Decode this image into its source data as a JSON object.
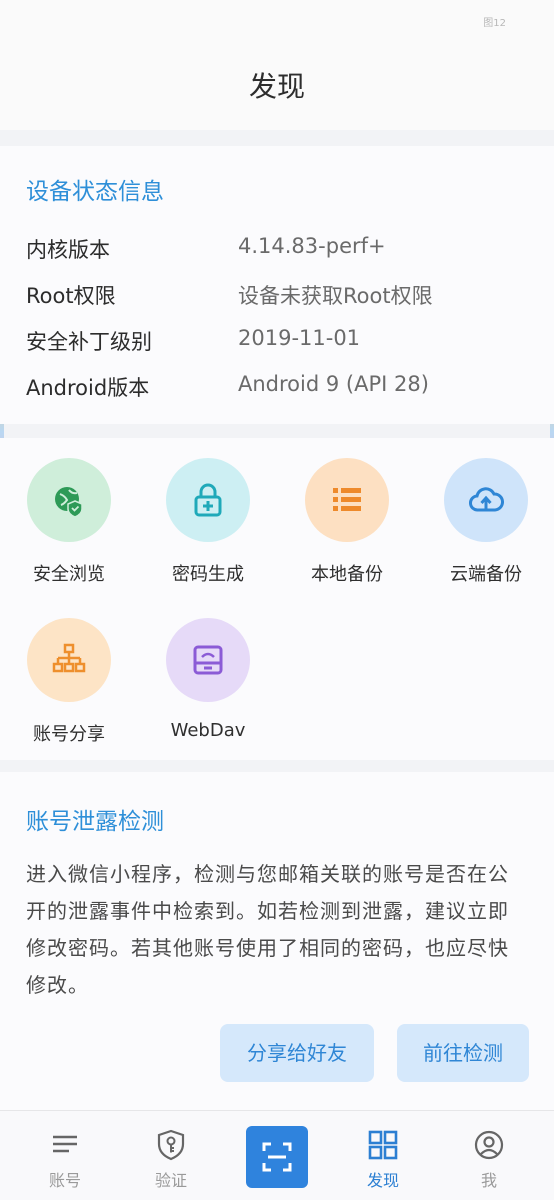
{
  "status_bar": {
    "text": "图12"
  },
  "header": {
    "title": "发现"
  },
  "device_info": {
    "title": "设备状态信息",
    "rows": [
      {
        "label": "内核版本",
        "value": "4.14.83-perf+"
      },
      {
        "label": "Root权限",
        "value": "设备未获取Root权限"
      },
      {
        "label": "安全补丁级别",
        "value": "2019-11-01"
      },
      {
        "label": "Android版本",
        "value": "Android 9 (API 28)"
      }
    ]
  },
  "tools": [
    {
      "label": "安全浏览",
      "icon": "shield-globe-icon",
      "color": "#cfeeda",
      "icon_color": "#2e9a57"
    },
    {
      "label": "密码生成",
      "icon": "lock-plus-icon",
      "color": "#cdeff3",
      "icon_color": "#1fa9b9"
    },
    {
      "label": "本地备份",
      "icon": "list-icon",
      "color": "#fde0c2",
      "icon_color": "#ee8a2b"
    },
    {
      "label": "云端备份",
      "icon": "cloud-upload-icon",
      "color": "#cfe4fa",
      "icon_color": "#2f86d5"
    },
    {
      "label": "账号分享",
      "icon": "share-tree-icon",
      "color": "#fde4c6",
      "icon_color": "#ee8f2d"
    },
    {
      "label": "WebDav",
      "icon": "drive-icon",
      "color": "#e6daf8",
      "icon_color": "#8b5bd6"
    }
  ],
  "leak_check": {
    "title": "账号泄露检测",
    "description": "进入微信小程序，检测与您邮箱关联的账号是否在公开的泄露事件中检索到。如若检测到泄露，建议立即修改密码。若其他账号使用了相同的密码，也应尽快修改。",
    "share_button": "分享给好友",
    "go_button": "前往检测"
  },
  "bottom_nav": {
    "items": [
      {
        "label": "账号",
        "icon": "menu-lines-icon"
      },
      {
        "label": "验证",
        "icon": "shield-key-icon"
      },
      {
        "label": "发现",
        "icon": "grid-icon",
        "active": true
      },
      {
        "label": "我",
        "icon": "user-circle-icon"
      }
    ],
    "scan_icon": "scan-icon"
  },
  "colors": {
    "accent": "#2f83dd",
    "title_blue": "#2e8fd8",
    "button_bg": "#d5e8fb"
  }
}
